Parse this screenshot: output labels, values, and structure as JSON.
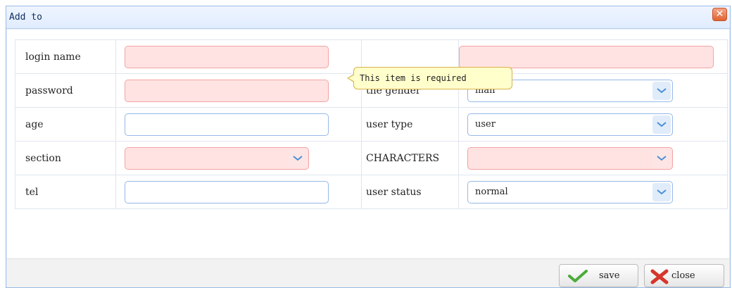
{
  "dialog": {
    "title": "Add to",
    "close_glyph": "✕"
  },
  "tooltip": {
    "text": "This item is required"
  },
  "rows": [
    {
      "label": "login name",
      "value": "",
      "right_label": "",
      "right_value": ""
    },
    {
      "label": "password",
      "value": "",
      "right_label": "the gender",
      "right_value": "man"
    },
    {
      "label": "age",
      "value": "",
      "right_label": "user type",
      "right_value": "user"
    },
    {
      "label": "section",
      "value": "",
      "right_label": "CHARACTERS",
      "right_value": ""
    },
    {
      "label": "tel",
      "value": "",
      "right_label": "user status",
      "right_value": "normal"
    }
  ],
  "buttons": {
    "save": "save",
    "close": "close"
  },
  "icons": {
    "save": "check-icon",
    "close": "cross-icon",
    "combo": "chevron-down-icon"
  },
  "colors": {
    "invalid_bg": "#ffe3e3",
    "border": "#95b8e7",
    "tooltip_bg": "#ffffcc",
    "accent": "#4cab3a"
  }
}
